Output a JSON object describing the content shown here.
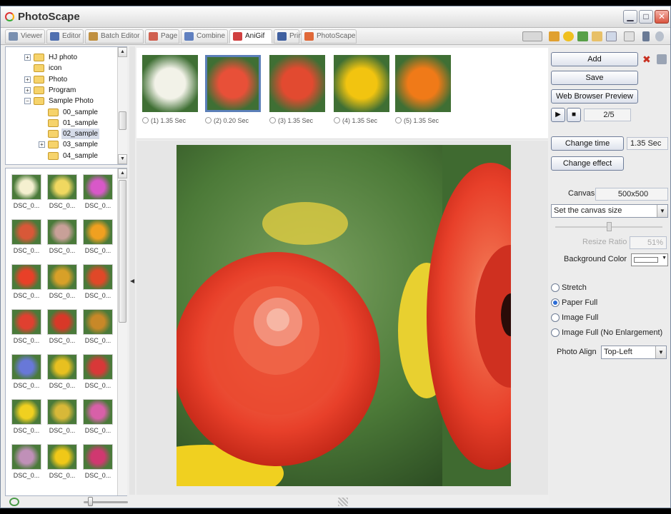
{
  "window": {
    "title": "PhotoScape",
    "controls": {
      "minimize": "▁",
      "maximize": "□",
      "close": "✕"
    }
  },
  "tabs": [
    {
      "label": "Viewer",
      "icon": "viewer-icon"
    },
    {
      "label": "Editor",
      "icon": "editor-icon"
    },
    {
      "label": "Batch Editor",
      "icon": "batch-editor-icon"
    },
    {
      "label": "Page",
      "icon": "page-icon"
    },
    {
      "label": "Combine",
      "icon": "combine-icon"
    },
    {
      "label": "AniGif",
      "icon": "anigif-icon",
      "active": true
    },
    {
      "label": "Print",
      "icon": "print-icon"
    },
    {
      "label": "PhotoScape",
      "icon": "photoscape-icon"
    }
  ],
  "folder_tree": [
    {
      "label": "HJ photo",
      "expander": "+"
    },
    {
      "label": "icon"
    },
    {
      "label": "Photo",
      "expander": "+"
    },
    {
      "label": "Program",
      "expander": "+"
    },
    {
      "label": "Sample Photo",
      "expander": "−"
    },
    {
      "label": "00_sample"
    },
    {
      "label": "01_sample"
    },
    {
      "label": "02_sample",
      "selected": true
    },
    {
      "label": "03_sample",
      "expander": "+"
    },
    {
      "label": "04_sample"
    }
  ],
  "thumbnails": {
    "caption": "DSC_0...",
    "colors": [
      [
        "#f5f0d0",
        "#f0d860",
        "#d858c8"
      ],
      [
        "#d85838",
        "#c8a098",
        "#f0a020"
      ],
      [
        "#e84028",
        "#d8a028",
        "#e04828"
      ],
      [
        "#e04030",
        "#d83828",
        "#c88828"
      ],
      [
        "#6878d8",
        "#e8c020",
        "#d83838"
      ],
      [
        "#f0d020",
        "#d8b838",
        "#d860a8"
      ],
      [
        "#c090b8",
        "#f0c818",
        "#d03870"
      ]
    ]
  },
  "filmstrip": [
    {
      "caption": "(1) 1.35 Sec",
      "color": "#f2f2e8"
    },
    {
      "caption": "(2) 0.20 Sec",
      "color": "#e85038",
      "selected": true
    },
    {
      "caption": "(3) 1.35 Sec",
      "color": "#e24a30"
    },
    {
      "caption": "(4) 1.35 Sec",
      "color": "#f2c410"
    },
    {
      "caption": "(5) 1.35 Sec",
      "color": "#f07a18"
    }
  ],
  "panel": {
    "add": "Add",
    "save": "Save",
    "web_preview": "Web Browser Preview",
    "frame_counter": "2/5",
    "change_time": "Change time",
    "time_value": "1.35 Sec",
    "change_effect": "Change effect",
    "canvas_label": "Canvas",
    "canvas_value": "500x500",
    "canvas_select": "Set the canvas size",
    "resize_ratio_label": "Resize Ratio",
    "resize_ratio_value": "51%",
    "bg_color_label": "Background Color",
    "fit_options": [
      {
        "label": "Stretch"
      },
      {
        "label": "Paper Full",
        "checked": true
      },
      {
        "label": "Image Full"
      },
      {
        "label": "Image Full (No Enlargement)"
      }
    ],
    "photo_align_label": "Photo Align",
    "photo_align_value": "Top-Left"
  },
  "colors": {
    "accent": "#2a6bd6",
    "flower": "#e8462a",
    "background_green": "#4d7a3a"
  }
}
